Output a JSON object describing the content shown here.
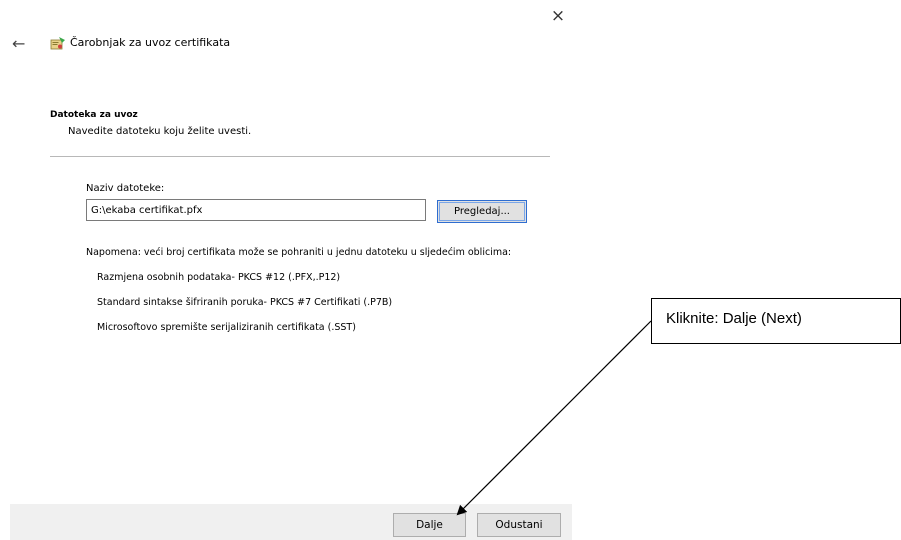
{
  "window": {
    "close_glyph": "×",
    "back_glyph": "←",
    "title": "Čarobnjak za uvoz certifikata"
  },
  "section": {
    "title": "Datoteka za uvoz",
    "subtitle": "Navedite datoteku koju želite uvesti."
  },
  "file": {
    "label": "Naziv datoteke:",
    "value": "G:\\ekaba certifikat.pfx",
    "browse_label": "Pregledaj..."
  },
  "note": {
    "text": "Napomena: veći broj certifikata može se pohraniti u jednu datoteku u sljedećim oblicima:",
    "formats": [
      "Razmjena osobnih podataka- PKCS #12 (.PFX,.P12)",
      "Standard sintakse šifriranih poruka- PKCS #7 Certifikati (.P7B)",
      "Microsoftovo spremište serijaliziranih certifikata (.SST)"
    ]
  },
  "buttons": {
    "next": "Dalje",
    "cancel": "Odustani"
  },
  "callout": {
    "text": "Kliknite: Dalje (Next)"
  },
  "colors": {
    "footer_bg": "#f0f0f0",
    "button_bg": "#e1e1e1",
    "focus_border": "#2f6dd0"
  }
}
